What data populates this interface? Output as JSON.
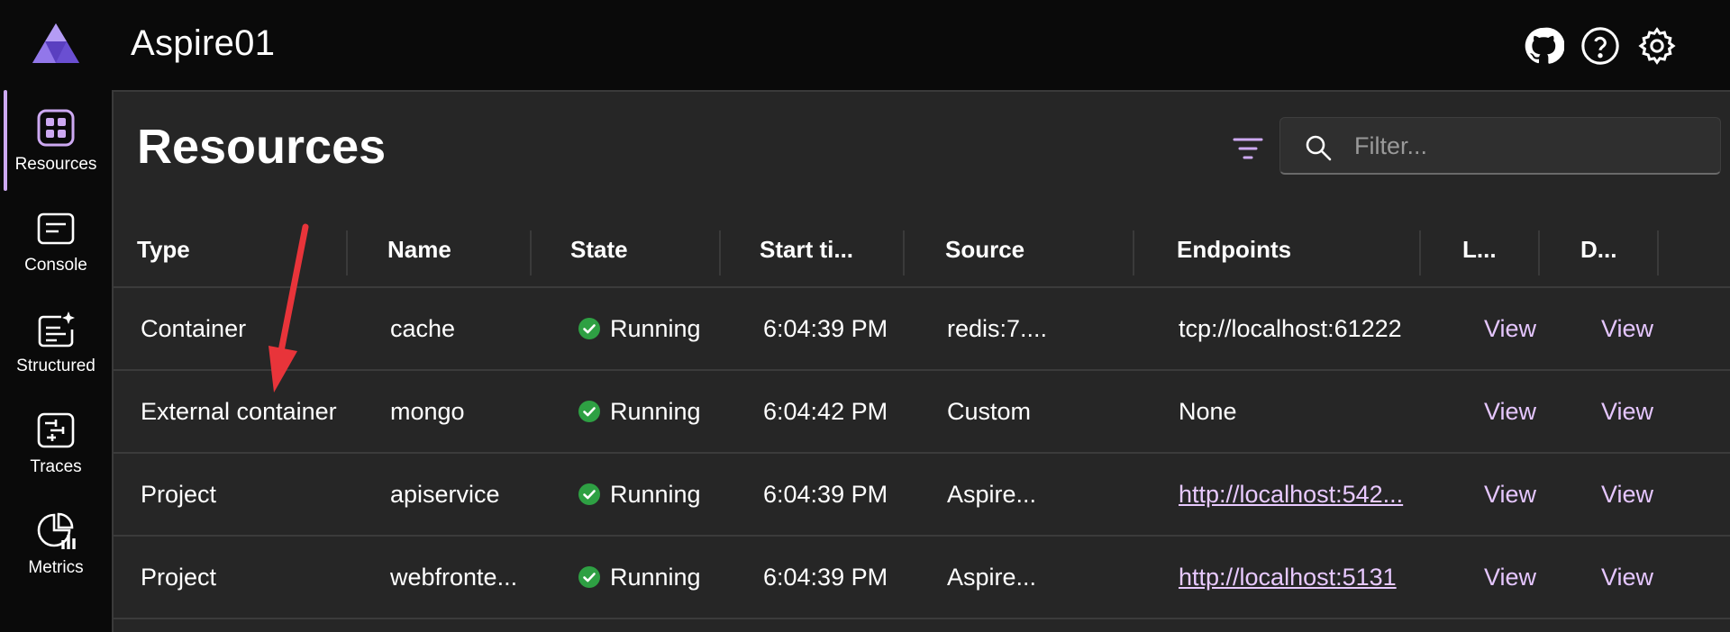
{
  "app": {
    "title": "Aspire01"
  },
  "header": {
    "icons": [
      "github-icon",
      "help-icon",
      "settings-icon"
    ]
  },
  "sidebar": {
    "items": [
      {
        "label": "Resources",
        "icon": "resources-icon",
        "active": true
      },
      {
        "label": "Console",
        "icon": "console-icon"
      },
      {
        "label": "Structured",
        "icon": "structured-icon"
      },
      {
        "label": "Traces",
        "icon": "traces-icon"
      },
      {
        "label": "Metrics",
        "icon": "metrics-icon"
      }
    ]
  },
  "main": {
    "title": "Resources",
    "search": {
      "placeholder": "Filter...",
      "value": ""
    }
  },
  "table": {
    "columns": [
      "Type",
      "Name",
      "State",
      "Start ti...",
      "Source",
      "Endpoints",
      "L...",
      "D..."
    ],
    "rows": [
      {
        "type": "Container",
        "name": "cache",
        "state": "Running",
        "start": "6:04:39 PM",
        "source": "redis:7....",
        "endpoint": "tcp://localhost:61222",
        "logs": "View",
        "details": "View"
      },
      {
        "type": "External container",
        "name": "mongo",
        "state": "Running",
        "start": "6:04:42 PM",
        "source": "Custom",
        "endpoint": "None",
        "logs": "View",
        "details": "View"
      },
      {
        "type": "Project",
        "name": "apiservice",
        "state": "Running",
        "start": "6:04:39 PM",
        "source": "Aspire...",
        "endpoint": "http://localhost:542...",
        "logs": "View",
        "details": "View"
      },
      {
        "type": "Project",
        "name": "webfronte...",
        "state": "Running",
        "start": "6:04:39 PM",
        "source": "Aspire...",
        "endpoint": "http://localhost:5131",
        "logs": "View",
        "details": "View"
      }
    ]
  },
  "colors": {
    "accent": "#cda9f2",
    "link": "#e5c6ff",
    "running": "#2ea043",
    "annotation_arrow": "#e8343a"
  }
}
